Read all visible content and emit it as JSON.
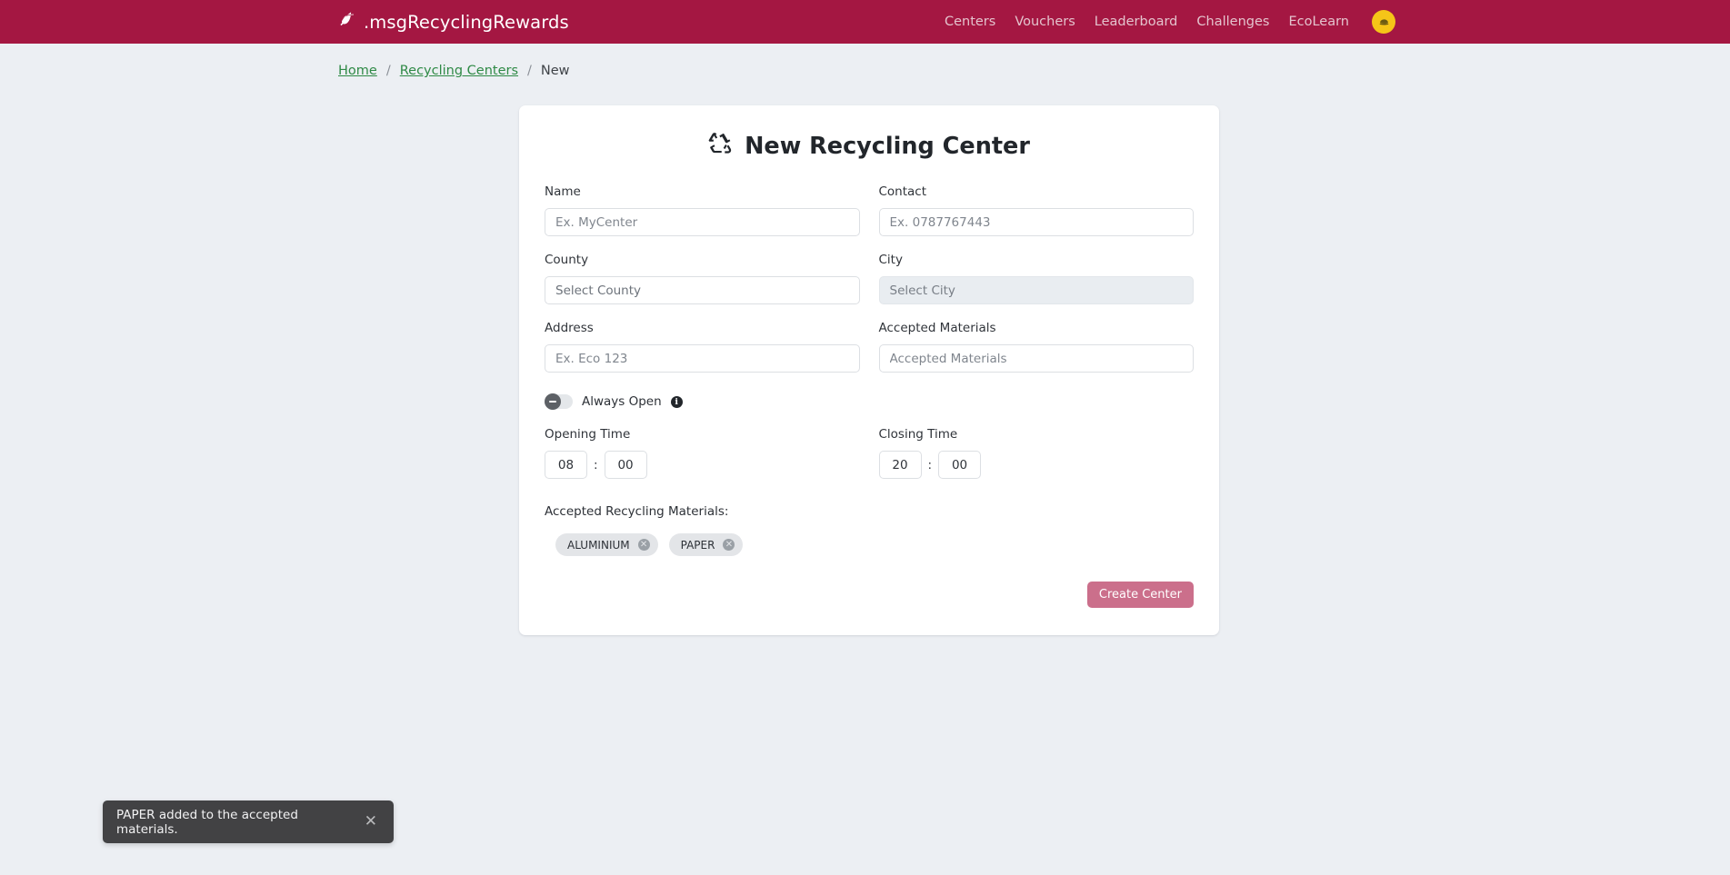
{
  "navbar": {
    "brand": ".msgRecyclingRewards",
    "brand_icon": "leaf-icon",
    "background": "#a41742",
    "links": [
      {
        "label": "Centers"
      },
      {
        "label": "Vouchers"
      },
      {
        "label": "Leaderboard"
      },
      {
        "label": "Challenges"
      },
      {
        "label": "EcoLearn"
      }
    ],
    "avatar": {
      "icon": "user-avatar-icon",
      "color": "#f5c518"
    }
  },
  "breadcrumb": {
    "home": "Home",
    "sep1": "/",
    "centers": "Recycling Centers",
    "sep2": "/",
    "current": "New",
    "link_color": "#2f8a46"
  },
  "card": {
    "title": "New Recycling Center",
    "title_icon": "recycle-icon",
    "fields": {
      "name": {
        "label": "Name",
        "placeholder": "Ex. MyCenter",
        "value": ""
      },
      "contact": {
        "label": "Contact",
        "placeholder": "Ex. 0787767443",
        "value": ""
      },
      "county": {
        "label": "County",
        "placeholder": "Select County",
        "value": "",
        "disabled": false
      },
      "city": {
        "label": "City",
        "placeholder": "Select City",
        "value": "",
        "disabled": true
      },
      "address": {
        "label": "Address",
        "placeholder": "Ex. Eco 123",
        "value": ""
      },
      "accepted_materials": {
        "label": "Accepted Materials",
        "placeholder": "Accepted Materials",
        "value": ""
      }
    },
    "always_open": {
      "label": "Always Open",
      "state": "off",
      "info_icon": "info-icon",
      "info_glyph": "i"
    },
    "opening_time": {
      "label": "Opening Time",
      "hours": "08",
      "minutes": "00",
      "separator": ":"
    },
    "closing_time": {
      "label": "Closing Time",
      "hours": "20",
      "minutes": "00",
      "separator": ":"
    },
    "materials_section": {
      "title": "Accepted Recycling Materials:",
      "chips": [
        {
          "label": "ALUMINIUM",
          "remove_icon": "close-icon",
          "remove_glyph": "✕"
        },
        {
          "label": "PAPER",
          "remove_icon": "close-icon",
          "remove_glyph": "✕"
        }
      ]
    },
    "submit": {
      "label": "Create Center",
      "color": "#cb6f8b"
    }
  },
  "toast": {
    "message": "PAPER added to the accepted materials.",
    "close_glyph": "✕",
    "background": "#424244"
  }
}
